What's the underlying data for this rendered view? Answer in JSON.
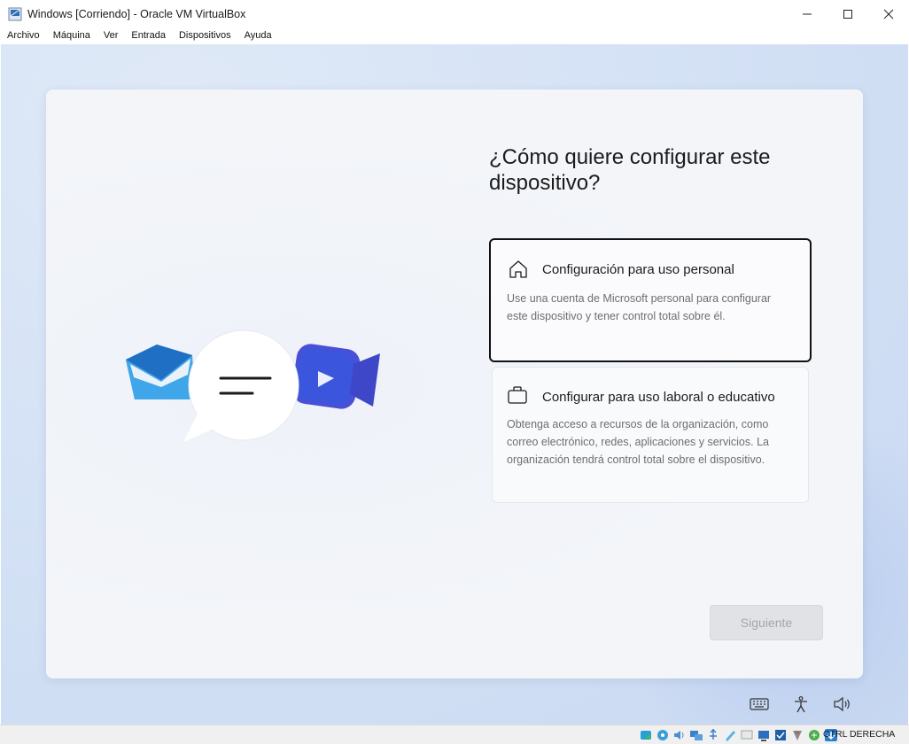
{
  "window": {
    "title": "Windows [Corriendo] - Oracle VM VirtualBox"
  },
  "menu": [
    "Archivo",
    "Máquina",
    "Ver",
    "Entrada",
    "Dispositivos",
    "Ayuda"
  ],
  "oobe": {
    "heading": "¿Cómo quiere configurar este dispositivo?",
    "options": [
      {
        "title": "Configuración para uso personal",
        "description": "Use una cuenta de Microsoft personal para configurar este dispositivo y tener control total sobre él.",
        "icon": "home-icon",
        "selected": true
      },
      {
        "title": "Configurar para uso laboral o educativo",
        "description": "Obtenga acceso a recursos de la organización, como correo electrónico, redes, aplicaciones y servicios. La organización tendrá control total sobre el dispositivo.",
        "icon": "briefcase-icon",
        "selected": false
      }
    ],
    "next_button": "Siguiente",
    "next_enabled": false
  },
  "statusbar": {
    "host_key": "CTRL DERECHA"
  },
  "colors": {
    "accent_blue": "#0f6cbd",
    "selected_border": "#111111",
    "disabled_button": "#e0e2e6"
  }
}
